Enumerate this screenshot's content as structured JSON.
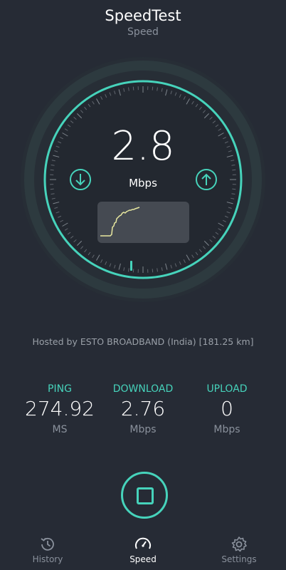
{
  "header": {
    "title": "SpeedTest",
    "subtitle": "Speed"
  },
  "gauge": {
    "value": "2.8",
    "unit": "Mbps",
    "download_icon": "arrow-down-circle-icon",
    "upload_icon": "arrow-up-circle-icon",
    "accent": "#46d3bb"
  },
  "host_text": "Hosted by ESTO BROADBAND (India) [181.25 km]",
  "stats": {
    "ping": {
      "label": "PING",
      "value": "274.92",
      "unit": "MS"
    },
    "download": {
      "label": "DOWNLOAD",
      "value": "2.76",
      "unit": "Mbps"
    },
    "upload": {
      "label": "UPLOAD",
      "value": "0",
      "unit": "Mbps"
    }
  },
  "stop_button": {
    "icon": "stop-icon"
  },
  "nav": [
    {
      "label": "History",
      "icon": "history-icon",
      "active": false
    },
    {
      "label": "Speed",
      "icon": "speedometer-icon",
      "active": true
    },
    {
      "label": "Settings",
      "icon": "gear-icon",
      "active": false
    }
  ]
}
